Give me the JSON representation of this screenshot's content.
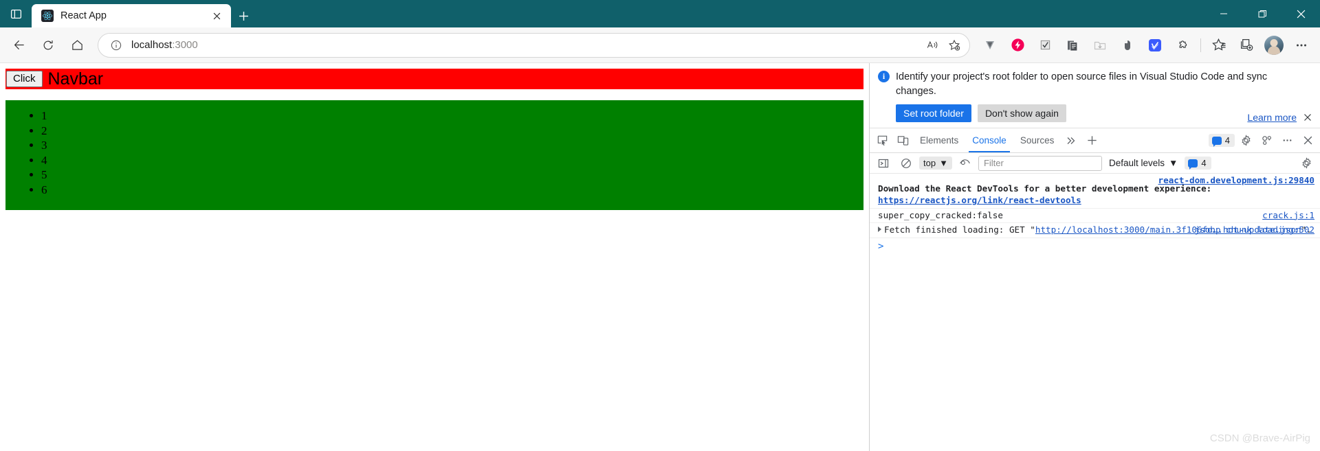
{
  "browser": {
    "tab": {
      "title": "React App",
      "favicon": "react-logo-icon",
      "close": "×"
    },
    "new_tab_label": "+",
    "window_controls": {
      "minimize": "minimize-icon",
      "maximize": "maximize-icon",
      "close": "close-icon"
    },
    "nav": {
      "back": "back-arrow-icon",
      "reload": "reload-icon",
      "home": "home-icon"
    },
    "omnibox": {
      "info_icon": "info-circle-icon",
      "url_host": "localhost",
      "url_port": ":3000",
      "read_aloud": "read-aloud-icon",
      "add_favorite": "add-favorite-icon"
    },
    "extensions": [
      {
        "name": "vimium-icon"
      },
      {
        "name": "lightning-red-icon"
      },
      {
        "name": "checkmark-box-icon"
      },
      {
        "name": "copy-document-icon"
      },
      {
        "name": "download-folder-icon"
      },
      {
        "name": "mouse-gesture-icon"
      },
      {
        "name": "blue-app-icon"
      },
      {
        "name": "extensions-puzzle-icon"
      }
    ],
    "toolbar_right": {
      "favorites": "favorites-star-icon",
      "collections": "collections-icon",
      "profile": "profile-avatar",
      "settings_more": "more-ellipsis-icon"
    },
    "colors": {
      "chrome": "#10606a",
      "accent": "#1a73e8"
    }
  },
  "page": {
    "navbar": {
      "button_label": "Click",
      "title": "Navbar",
      "background": "#ff0000"
    },
    "list": {
      "background": "#008000",
      "items": [
        "1",
        "2",
        "3",
        "4",
        "5",
        "6"
      ]
    }
  },
  "devtools": {
    "infobar": {
      "icon": "info-icon",
      "message": "Identify your project's root folder to open source files in Visual Studio Code and sync changes.",
      "primary_button": "Set root folder",
      "secondary_button": "Don't show again",
      "learn_more": "Learn more",
      "close": "×"
    },
    "tabbar": {
      "inspect_icon": "inspect-element-icon",
      "device_icon": "device-toolbar-icon",
      "tabs": [
        {
          "label": "Elements",
          "active": false
        },
        {
          "label": "Console",
          "active": true
        },
        {
          "label": "Sources",
          "active": false
        }
      ],
      "more_tabs": "»",
      "add_tab": "+",
      "issues_count": "4",
      "settings_icon": "gear-icon",
      "customize_icon": "devtools-customize-icon",
      "more_icon": "more-ellipsis-icon",
      "close_icon": "close-icon"
    },
    "console_toolbar": {
      "sidebar_icon": "console-sidebar-icon",
      "clear_icon": "clear-console-icon",
      "context": "top",
      "context_caret": "▼",
      "eye_icon": "live-expression-icon",
      "filter_placeholder": "Filter",
      "filter_value": "",
      "levels_label": "Default levels",
      "levels_caret": "▼",
      "issues_count": "4",
      "settings_icon": "gear-icon"
    },
    "console_messages": [
      {
        "kind": "react-devtools",
        "source": "react-dom.development.js:29840",
        "text_prefix": "Download the React DevTools for a better development experience: ",
        "link": "https://reactjs.org/link/react-devtools"
      },
      {
        "kind": "plain",
        "source": "crack.js:1",
        "text": "super_copy_cracked:false"
      },
      {
        "kind": "fetch",
        "source": "jsonp chunk loading:502",
        "prefix": "Fetch finished loading: GET \"",
        "link": "http://localhost:3000/main.3f106fd….hot-update.json",
        "suffix": "\"."
      }
    ],
    "prompt": ">"
  },
  "watermark": "CSDN @Brave-AirPig"
}
